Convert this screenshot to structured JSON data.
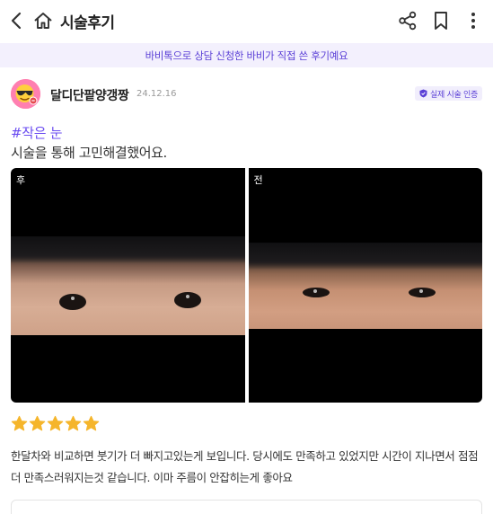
{
  "header": {
    "title": "시술후기",
    "icons": [
      "back-arrow-icon",
      "home-icon",
      "share-icon",
      "bookmark-icon",
      "more-vertical-icon"
    ]
  },
  "banner": {
    "text": "바비톡으로 상담 신청한 바비가 직접 쓴 후기예요"
  },
  "review": {
    "author": "달디단팥양갱짱",
    "date": "24.12.16",
    "verified_badge": "실제 시술 인증",
    "tag": "#작은 눈",
    "headline": "시술을 통해 고민해결했어요.",
    "photos": [
      {
        "label": "후"
      },
      {
        "label": "전"
      }
    ],
    "rating": 5,
    "star_color": "#f5b52b",
    "body": "한달차와 비교하면 붓기가 더 빠지고있는게 보입니다. 당시에도 만족하고 있었지만 시간이 지나면서 점점 더 만족스러워지는것 같습니다. 이마 주름이 안잡히는게 좋아요"
  },
  "colors": {
    "accent": "#6a4cf0",
    "banner_bg": "#f3f0fd"
  }
}
